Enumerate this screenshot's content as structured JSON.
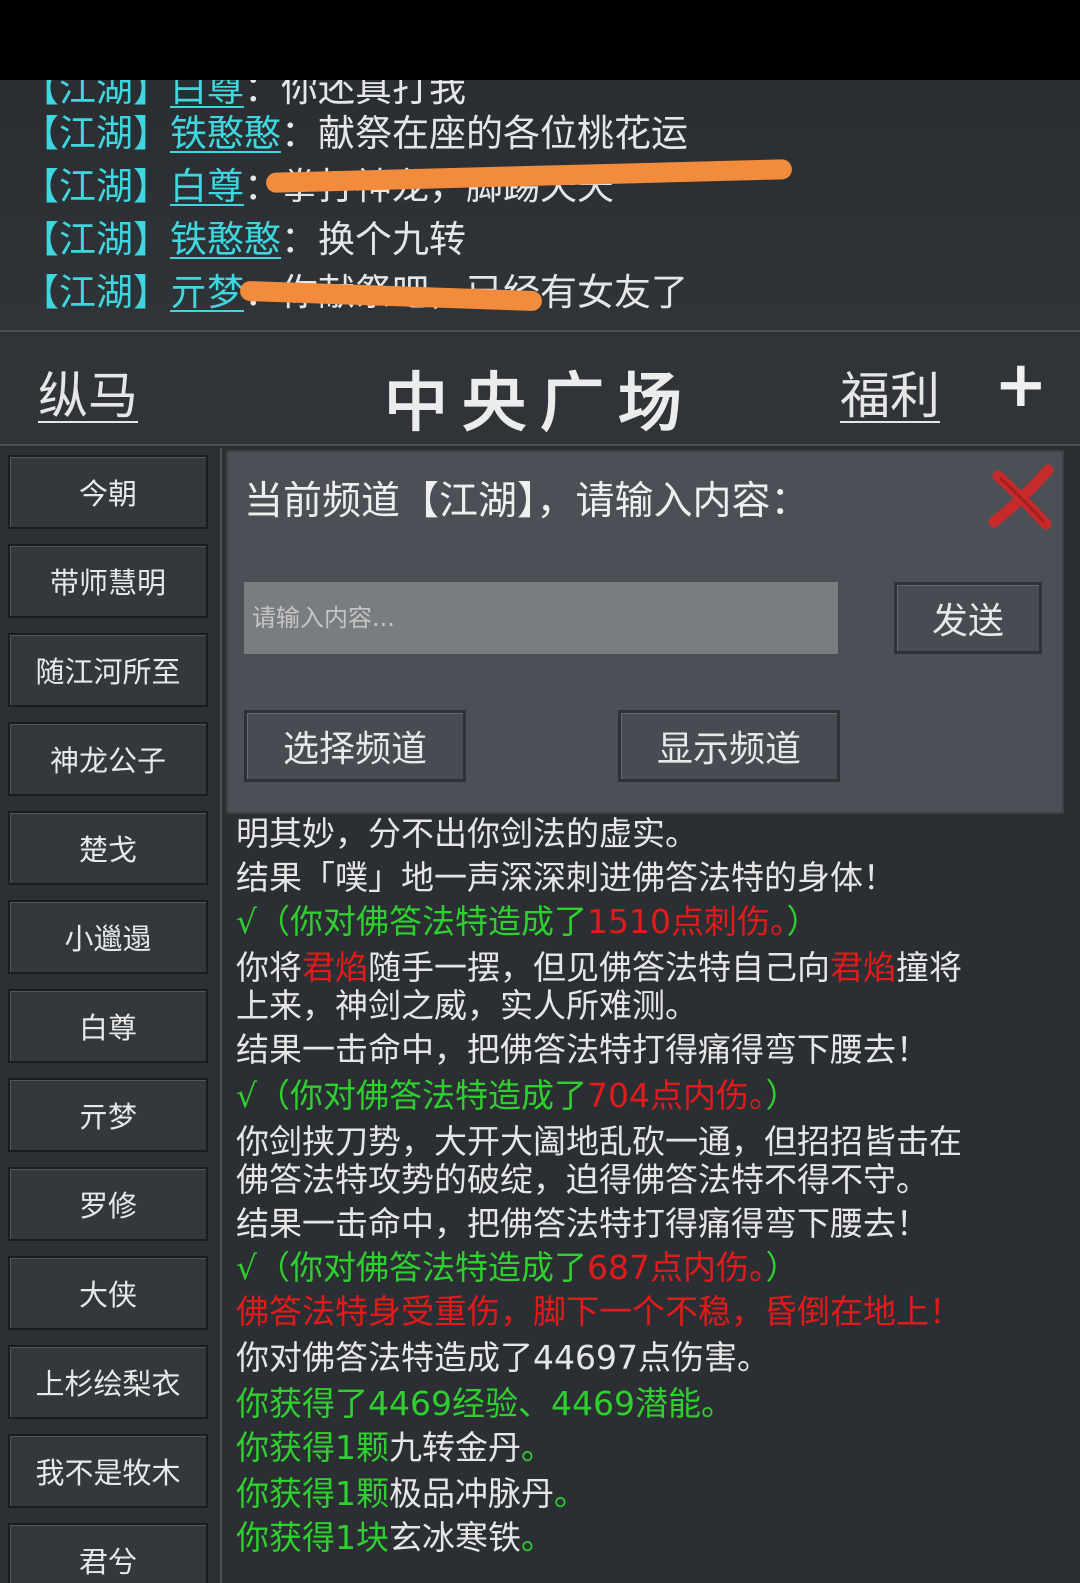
{
  "chat": [
    {
      "tag": "【江湖】",
      "user": "白尊",
      "msg": "你还真打我"
    },
    {
      "tag": "【江湖】",
      "user": "铁憨憨",
      "msg": "献祭在座的各位桃花运"
    },
    {
      "tag": "【江湖】",
      "user": "白尊",
      "msg": "拳打神龙，脚踢天天"
    },
    {
      "tag": "【江湖】",
      "user": "铁憨憨",
      "msg": "换个九转"
    },
    {
      "tag": "【江湖】",
      "user": "亓梦",
      "msg": "你献祭吧，已经有女友了"
    }
  ],
  "header": {
    "left": "纵马",
    "title": "中央广场",
    "welfare": "福利",
    "plus": "+"
  },
  "sidebar": [
    "今朝",
    "带师慧明",
    "随江河所至",
    "神龙公子",
    "楚戈",
    "小邋遢",
    "白尊",
    "亓梦",
    "罗修",
    "大侠",
    "上杉绘梨衣",
    "我不是牧木",
    "君兮"
  ],
  "dialog": {
    "title": "当前频道【江湖】，请输入内容：",
    "placeholder": "请输入内容...",
    "send": "发送",
    "select_channel": "选择频道",
    "show_channel": "显示频道"
  },
  "battle_log": [
    [
      {
        "t": "明其妙，分不出你剑法的虚实。",
        "c": "white"
      }
    ],
    [
      {
        "t": "结果「噗」地一声深深刺进佛答法特的身体！",
        "c": "white"
      }
    ],
    [
      {
        "t": "√（你对佛答法特造成了",
        "c": "green"
      },
      {
        "t": "1510点刺伤。",
        "c": "red"
      },
      {
        "t": "）",
        "c": "green"
      }
    ],
    [
      {
        "t": "你将",
        "c": "white"
      },
      {
        "t": "君焰",
        "c": "red"
      },
      {
        "t": "随手一摆，但见佛答法特自己向",
        "c": "white"
      },
      {
        "t": "君焰",
        "c": "red"
      },
      {
        "t": "撞将",
        "c": "white"
      }
    ],
    [
      {
        "t": "上来，神剑之威，实人所难测。",
        "c": "white"
      }
    ],
    [
      {
        "t": "结果一击命中，把佛答法特打得痛得弯下腰去！",
        "c": "white"
      }
    ],
    [
      {
        "t": "√（你对佛答法特造成了",
        "c": "green"
      },
      {
        "t": "704点内伤。",
        "c": "red"
      },
      {
        "t": "）",
        "c": "green"
      }
    ],
    [
      {
        "t": "你剑挟刀势，大开大阖地乱砍一通，但招招皆击在",
        "c": "white"
      }
    ],
    [
      {
        "t": "佛答法特攻势的破绽，迫得佛答法特不得不守。",
        "c": "white"
      }
    ],
    [
      {
        "t": "结果一击命中，把佛答法特打得痛得弯下腰去！",
        "c": "white"
      }
    ],
    [
      {
        "t": "√（你对佛答法特造成了",
        "c": "green"
      },
      {
        "t": "687点内伤。",
        "c": "red"
      },
      {
        "t": "）",
        "c": "green"
      }
    ],
    [
      {
        "t": "佛答法特身受重伤，脚下一个不稳，昏倒在地上！",
        "c": "red"
      }
    ],
    [
      {
        "t": "你对佛答法特造成了44697点伤害。",
        "c": "white"
      }
    ],
    [
      {
        "t": "你获得了4469经验、4469潜能。",
        "c": "green"
      }
    ],
    [
      {
        "t": "你获得1颗",
        "c": "green"
      },
      {
        "t": "九转金丹",
        "c": "white"
      },
      {
        "t": "。",
        "c": "green"
      }
    ],
    [
      {
        "t": "你获得1颗",
        "c": "green"
      },
      {
        "t": "极品冲脉丹",
        "c": "white"
      },
      {
        "t": "。",
        "c": "green"
      }
    ],
    [
      {
        "t": "你获得1块",
        "c": "green"
      },
      {
        "t": "玄冰寒铁",
        "c": "white"
      },
      {
        "t": "。",
        "c": "green"
      }
    ]
  ],
  "colors": {
    "channel_cyan": "#40d6df",
    "scribble_orange": "#f28c3c",
    "log_green": "#2fcf2f",
    "log_red": "#e11a1a"
  }
}
